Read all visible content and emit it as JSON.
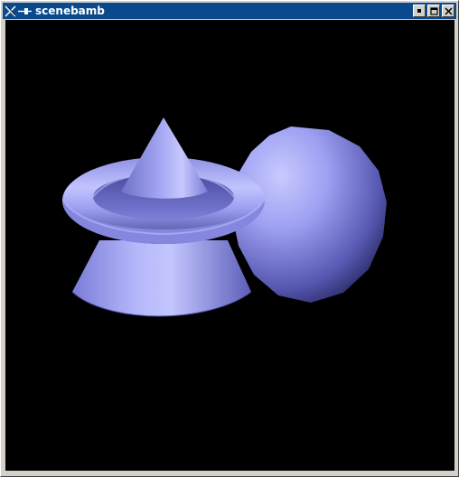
{
  "window": {
    "title": "scenebamb",
    "icon": "x-window-icon",
    "controls": [
      "minimize-icon",
      "maximize-icon",
      "close-icon"
    ]
  },
  "scene": {
    "objects": [
      "cone",
      "torus",
      "truncated-cone",
      "sphere"
    ],
    "background_color": "#000000",
    "object_color": "#9a9cf0"
  }
}
